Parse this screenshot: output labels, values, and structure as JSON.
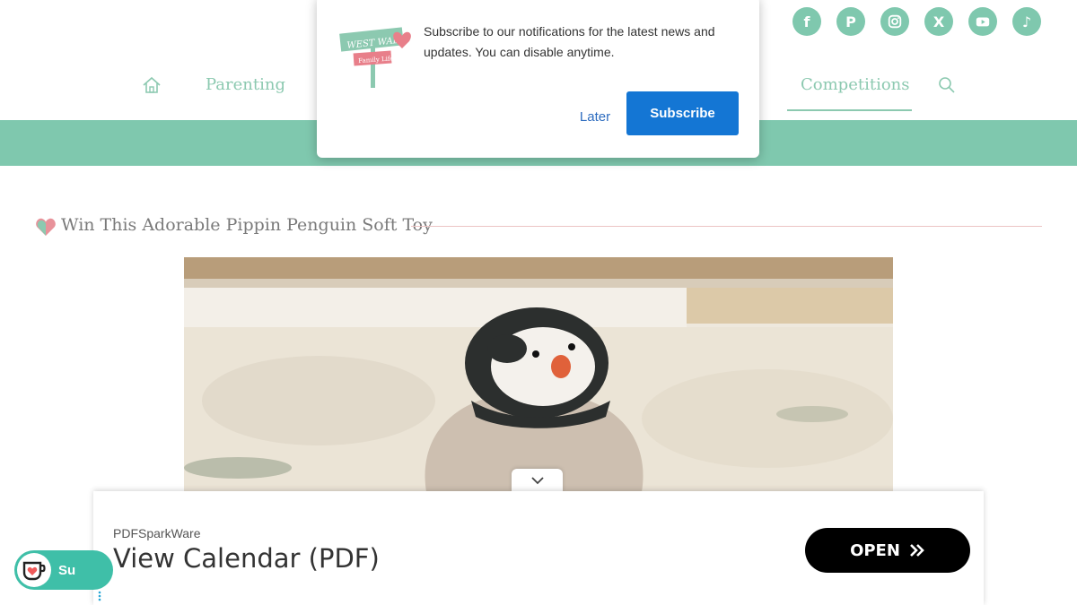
{
  "social": [
    {
      "icon": "facebook-icon",
      "glyph": "f"
    },
    {
      "icon": "pinterest-icon",
      "glyph": "P"
    },
    {
      "icon": "instagram-icon",
      "glyph": ""
    },
    {
      "icon": "x-icon",
      "glyph": "X"
    },
    {
      "icon": "youtube-icon",
      "glyph": ""
    },
    {
      "icon": "tiktok-icon",
      "glyph": "♪"
    }
  ],
  "nav": {
    "parenting": "Parenting",
    "competitions": "Competitions"
  },
  "popup": {
    "logo_line1": "WEST WALES",
    "logo_line2": "Family Life",
    "message": "Subscribe to our notifications for the latest news and updates. You can disable anytime.",
    "later": "Later",
    "subscribe": "Subscribe"
  },
  "post": {
    "title": "Win This Adorable Pippin Penguin Soft Toy"
  },
  "ad": {
    "brand": "PDFSparkWare",
    "headline": "View Calendar (PDF)",
    "open": "OPEN"
  },
  "support": {
    "label": "Su"
  },
  "colors": {
    "accent": "#7fc8ae",
    "subscribe": "#1476d4",
    "support": "#3fbfa8"
  }
}
